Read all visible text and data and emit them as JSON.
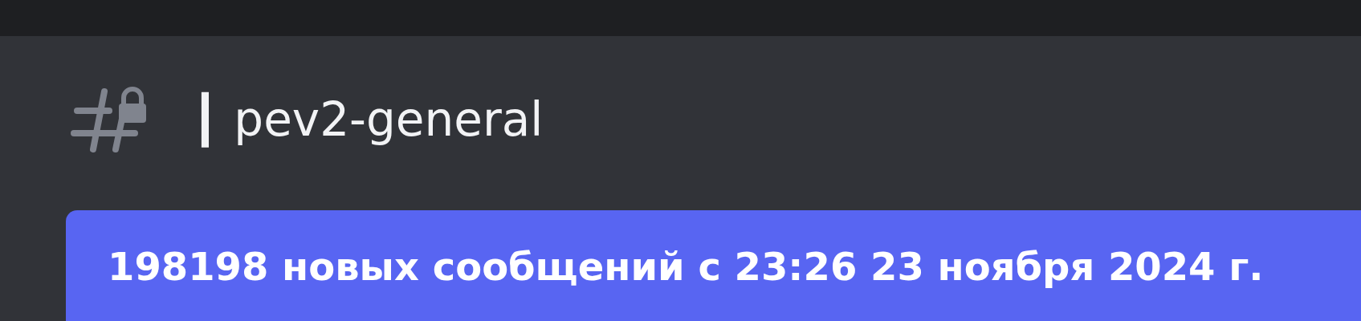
{
  "header": {
    "channel_name": "┃ pev2-general"
  },
  "new_messages_banner": {
    "text": "198198 новых сообщений с 23:26 23 ноября 2024 г."
  }
}
